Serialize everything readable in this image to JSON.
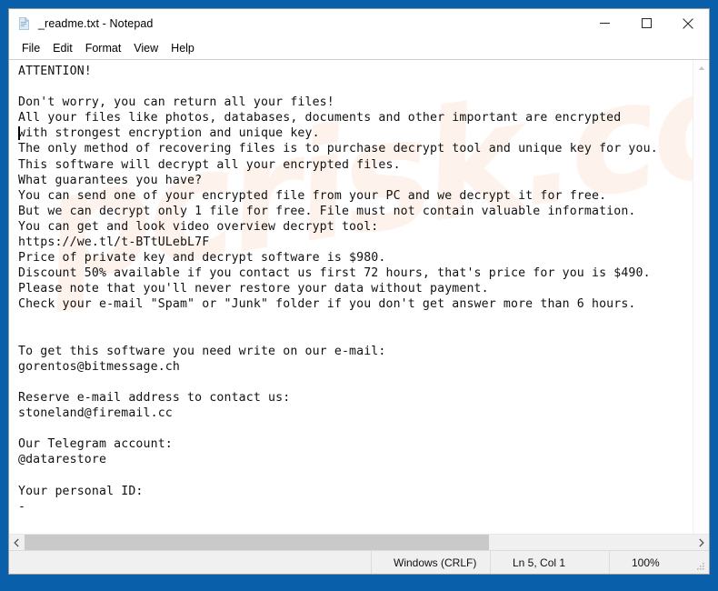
{
  "window": {
    "title": "_readme.txt - Notepad",
    "icon": "notepad-document-icon",
    "caption": {
      "minimize": "minimize-icon",
      "maximize": "maximize-icon",
      "close": "close-icon"
    }
  },
  "menubar": {
    "items": [
      {
        "label": "File"
      },
      {
        "label": "Edit"
      },
      {
        "label": "Format"
      },
      {
        "label": "View"
      },
      {
        "label": "Help"
      }
    ]
  },
  "editor": {
    "watermark": "pcrisk.com",
    "lines": [
      "ATTENTION!",
      "",
      "Don't worry, you can return all your files!",
      "All your files like photos, databases, documents and other important are encrypted",
      "with strongest encryption and unique key.",
      "The only method of recovering files is to purchase decrypt tool and unique key for you.",
      "This software will decrypt all your encrypted files.",
      "What guarantees you have?",
      "You can send one of your encrypted file from your PC and we decrypt it for free.",
      "But we can decrypt only 1 file for free. File must not contain valuable information.",
      "You can get and look video overview decrypt tool:",
      "https://we.tl/t-BTtULebL7F",
      "Price of private key and decrypt software is $980.",
      "Discount 50% available if you contact us first 72 hours, that's price for you is $490.",
      "Please note that you'll never restore your data without payment.",
      "Check your e-mail \"Spam\" or \"Junk\" folder if you don't get answer more than 6 hours.",
      "",
      "",
      "To get this software you need write on our e-mail:",
      "gorentos@bitmessage.ch",
      "",
      "Reserve e-mail address to contact us:",
      "stoneland@firemail.cc",
      "",
      "Our Telegram account:",
      "@datarestore",
      "",
      "Your personal ID:",
      "-"
    ],
    "details": {
      "video_url": "https://we.tl/t-BTtULebL7F",
      "price_full": "$980",
      "price_discount": "$490",
      "discount_percent": "50%",
      "discount_window_hours": "72",
      "response_time_hours": "6",
      "free_decrypt_files": "1",
      "primary_email": "gorentos@bitmessage.ch",
      "reserve_email": "stoneland@firemail.cc",
      "telegram": "@datarestore",
      "personal_id": "-"
    }
  },
  "scrollbars": {
    "vertical": {
      "up_arrow": "scroll-up-icon",
      "down_arrow": "scroll-down-icon"
    },
    "horizontal": {
      "left_arrow": "scroll-left-icon",
      "right_arrow": "scroll-right-icon"
    }
  },
  "statusbar": {
    "line_ending": "Windows (CRLF)",
    "cursor_position": "Ln 5, Col 1",
    "zoom": "100%",
    "grip": "resize-grip-icon"
  },
  "colors": {
    "desktop_blue": "#0A5FAB",
    "window_bg": "#FFFFFF",
    "statusbar_bg": "#F0F0F0",
    "scroll_thumb": "#C9C9C9",
    "watermark": "#FDF3EC",
    "text": "#111111"
  }
}
